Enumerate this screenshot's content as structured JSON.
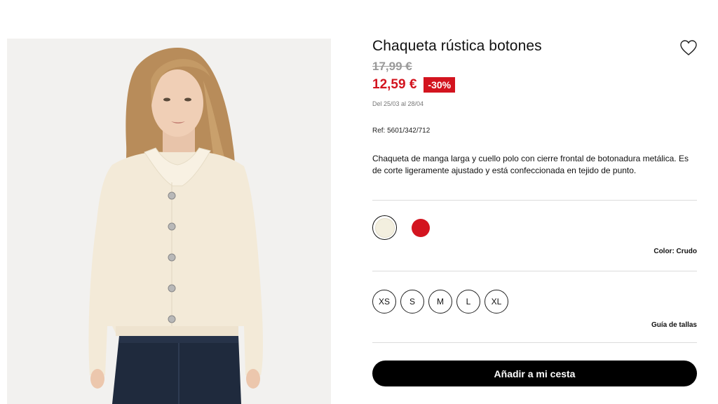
{
  "product": {
    "title": "Chaqueta rústica botones",
    "old_price": "17,99 €",
    "new_price": "12,59 €",
    "discount": "-30%",
    "dates": "Del 25/03 al 28/04",
    "ref": "Ref: 5601/342/712",
    "description": "Chaqueta de manga larga y cuello polo con cierre frontal de botonadura metálica. Es de corte ligeramente ajustado y está confeccionada en tejido de punto.",
    "image_alt_icon": "product-photo",
    "favorite_icon": "heart-outline-icon"
  },
  "colors": {
    "options": [
      {
        "name": "Crudo",
        "hex": "#f3efdf",
        "selected": true
      },
      {
        "name": "Rojo",
        "hex": "#d3141f",
        "selected": false
      }
    ],
    "label": "Color: Crudo"
  },
  "sizes": {
    "options": [
      "XS",
      "S",
      "M",
      "L",
      "XL"
    ],
    "guide_label": "Guía de tallas"
  },
  "cart": {
    "add_label": "Añadir a mi cesta"
  },
  "theme": {
    "sale_red": "#d3141f",
    "button_black": "#000000"
  }
}
